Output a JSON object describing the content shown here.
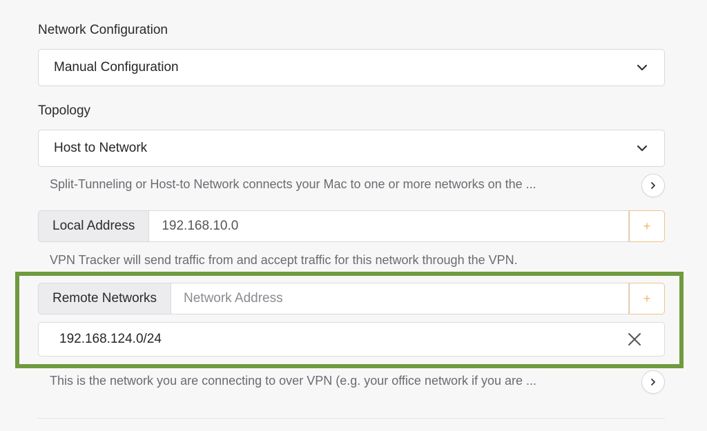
{
  "network_configuration": {
    "label": "Network Configuration",
    "selected": "Manual Configuration"
  },
  "topology": {
    "label": "Topology",
    "selected": "Host to Network",
    "hint": "Split-Tunneling or Host-to Network connects your Mac to one or more networks on the ..."
  },
  "local_address": {
    "label": "Local Address",
    "value": "192.168.10.0",
    "add_label": "+",
    "hint": "VPN Tracker will send traffic from and accept traffic for this network through the VPN."
  },
  "remote_networks": {
    "label": "Remote Networks",
    "placeholder": "Network Address",
    "add_label": "+",
    "items": [
      {
        "address": "192.168.124.0/24"
      }
    ],
    "hint": "This is the network you are connecting to over VPN (e.g. your office network if you are ..."
  },
  "icons": {
    "dropdown": "chevron-down-icon",
    "more": "chevron-right-icon",
    "remove": "close-icon"
  },
  "colors": {
    "highlight": "#6f9a3e",
    "add_accent": "#f0b56a"
  }
}
